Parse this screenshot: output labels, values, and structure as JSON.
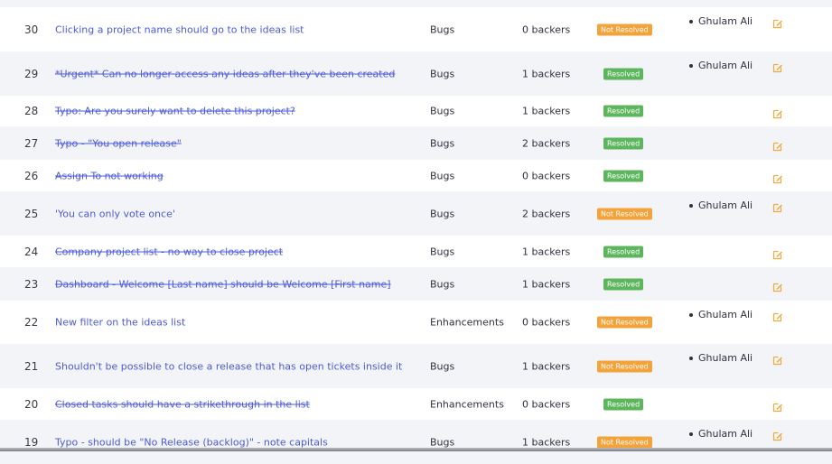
{
  "rows": [
    {
      "num": "30",
      "title": "Clicking a project name should go to the ideas list",
      "done": false,
      "category": "Bugs",
      "backers": "0 backers",
      "status": "Not Resolved",
      "resolved": false,
      "assignee": "Ghulam Ali"
    },
    {
      "num": "29",
      "title": "*Urgent* Can no longer access any ideas after they've been created",
      "done": true,
      "category": "Bugs",
      "backers": "1 backers",
      "status": "Resolved",
      "resolved": true,
      "assignee": "Ghulam Ali"
    },
    {
      "num": "28",
      "title": "Typo: Are you surely want to delete this project?",
      "done": true,
      "category": "Bugs",
      "backers": "1 backers",
      "status": "Resolved",
      "resolved": true,
      "assignee": ""
    },
    {
      "num": "27",
      "title": "Typo - \"You open release\"",
      "done": true,
      "category": "Bugs",
      "backers": "2 backers",
      "status": "Resolved",
      "resolved": true,
      "assignee": ""
    },
    {
      "num": "26",
      "title": "Assign To not working",
      "done": true,
      "category": "Bugs",
      "backers": "0 backers",
      "status": "Resolved",
      "resolved": true,
      "assignee": ""
    },
    {
      "num": "25",
      "title": "'You can only vote once'",
      "done": false,
      "category": "Bugs",
      "backers": "2 backers",
      "status": "Not Resolved",
      "resolved": false,
      "assignee": "Ghulam Ali"
    },
    {
      "num": "24",
      "title": "Company project list - no way to close project",
      "done": true,
      "category": "Bugs",
      "backers": "1 backers",
      "status": "Resolved",
      "resolved": true,
      "assignee": ""
    },
    {
      "num": "23",
      "title": "Dashboard - Welcome [Last name] should be Welcome [First name]",
      "done": true,
      "category": "Bugs",
      "backers": "1 backers",
      "status": "Resolved",
      "resolved": true,
      "assignee": ""
    },
    {
      "num": "22",
      "title": "New filter on the ideas list",
      "done": false,
      "category": "Enhancements",
      "backers": "0 backers",
      "status": "Not Resolved",
      "resolved": false,
      "assignee": "Ghulam Ali"
    },
    {
      "num": "21",
      "title": "Shouldn't be possible to close a release that has open tickets inside it",
      "done": false,
      "category": "Bugs",
      "backers": "1 backers",
      "status": "Not Resolved",
      "resolved": false,
      "assignee": "Ghulam Ali"
    },
    {
      "num": "20",
      "title": "Closed tasks should have a strikethrough in the list",
      "done": true,
      "category": "Enhancements",
      "backers": "0 backers",
      "status": "Resolved",
      "resolved": true,
      "assignee": ""
    },
    {
      "num": "19",
      "title": "Typo - should be \"No Release (backlog)\" - note capitals",
      "done": false,
      "category": "Bugs",
      "backers": "1 backers",
      "status": "Not Resolved",
      "resolved": false,
      "assignee": "Ghulam Ali"
    }
  ],
  "colors": {
    "link": "#4e5bd9",
    "resolved": "#5db65d",
    "not_resolved": "#f3a33a",
    "edit_icon": "#f0a93a"
  },
  "icons": {
    "edit": "edit-icon"
  }
}
